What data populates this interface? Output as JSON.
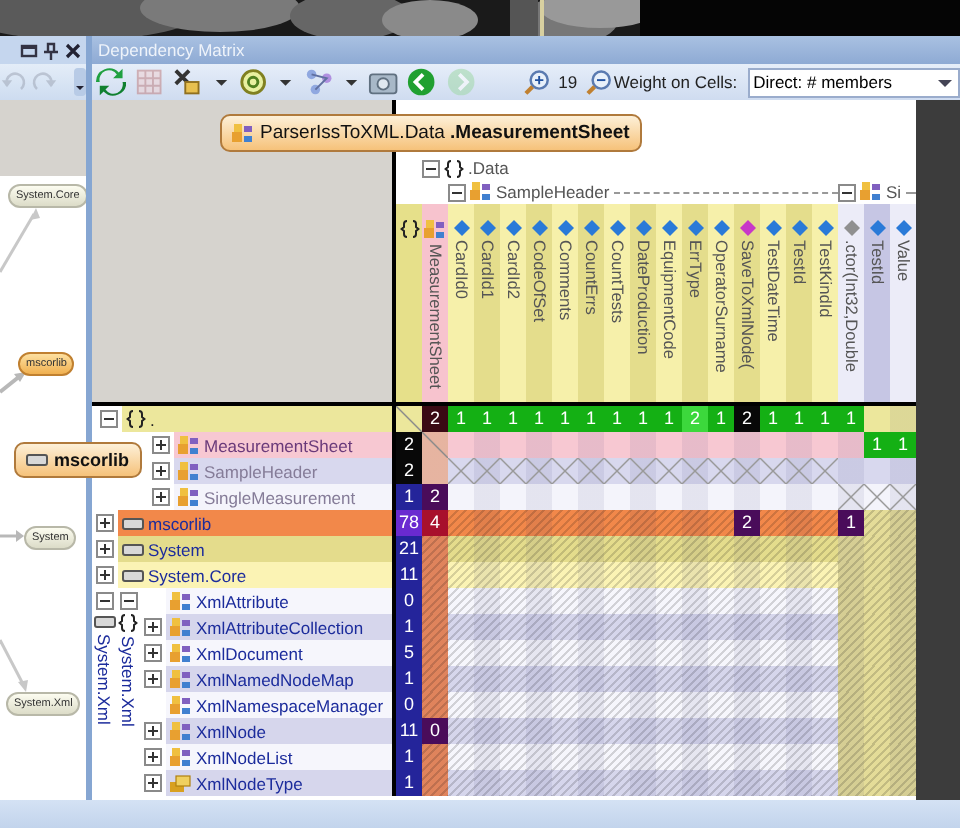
{
  "side_panel": {
    "buttons": [
      {
        "kind": "undo",
        "disabled": true
      },
      {
        "kind": "redo",
        "disabled": true
      }
    ],
    "graph_nodes": [
      {
        "label": "System.Core",
        "highlighted": false
      },
      {
        "label": "mscorlib",
        "highlighted": true
      },
      {
        "label": "System",
        "highlighted": false
      },
      {
        "label": "System.Xml",
        "highlighted": false
      }
    ]
  },
  "window": {
    "title": "Dependency Matrix"
  },
  "toolbar": {
    "buttons": [
      {
        "kind": "refresh",
        "disabled": false
      },
      {
        "kind": "grid",
        "disabled": true
      },
      {
        "kind": "tools",
        "disabled": false
      },
      {
        "kind": "caret",
        "disabled": false
      },
      {
        "kind": "ring",
        "disabled": false
      },
      {
        "kind": "caret",
        "disabled": false
      },
      {
        "kind": "graph",
        "disabled": false
      },
      {
        "kind": "caret",
        "disabled": false
      },
      {
        "kind": "camera",
        "disabled": false
      },
      {
        "kind": "back",
        "disabled": false
      },
      {
        "kind": "forward",
        "disabled": true
      }
    ],
    "zoom": "19",
    "weight_label": "Weight on Cells:",
    "weight_value": "Direct: # members"
  },
  "tooltips": [
    {
      "text": "ParserIssToXML.Data **.MeasurementSheet**",
      "kind": "class"
    },
    {
      "text": "mscorlib",
      "kind": "assembly"
    }
  ],
  "matrix": {
    "namespace": {
      "label": ".Data",
      "expanded": true
    },
    "columns": [
      {
        "kind": "namespace",
        "highlighted": false
      },
      {
        "label": "MeasurementSheet",
        "kind": "class",
        "highlighted": true
      }
    ],
    "groups": [
      {
        "label": "SampleHeader",
        "expanded": true,
        "columns": [
          {
            "label": "CardId0",
            "kind": "field",
            "highlighted": false
          },
          {
            "label": "CardId1",
            "kind": "field",
            "highlighted": false
          },
          {
            "label": "CardId2",
            "kind": "field",
            "highlighted": false
          },
          {
            "label": "CodeOfSet",
            "kind": "field",
            "highlighted": false
          },
          {
            "label": "Comments",
            "kind": "field",
            "highlighted": false
          },
          {
            "label": "CountErrs",
            "kind": "field",
            "highlighted": false
          },
          {
            "label": "CountTests",
            "kind": "field",
            "highlighted": false
          },
          {
            "label": "DateProduction",
            "kind": "field",
            "highlighted": false
          },
          {
            "label": "EquipmentCode",
            "kind": "field",
            "highlighted": false
          },
          {
            "label": "ErrType",
            "kind": "field",
            "highlighted": false
          },
          {
            "label": "OperatorSurname",
            "kind": "field",
            "highlighted": false
          },
          {
            "label": "SaveToXmlNode(",
            "kind": "method",
            "highlighted": false
          },
          {
            "label": "TestDateTime",
            "kind": "field",
            "highlighted": false
          },
          {
            "label": "TestId",
            "kind": "field",
            "highlighted": false
          },
          {
            "label": "TestKindId",
            "kind": "field",
            "highlighted": false
          }
        ]
      },
      {
        "label": "Si",
        "expanded": true,
        "columns": [
          {
            "label": ".ctor(Int32,Double",
            "kind": "ctor",
            "highlighted": false
          },
          {
            "label": "TestId",
            "kind": "field",
            "highlighted": false
          },
          {
            "label": "Value",
            "kind": "field",
            "highlighted": false
          }
        ]
      }
    ],
    "tree": [
      {
        "label": ".",
        "kind": "namespace",
        "expanded": true,
        "cells": [
          {
            "kind": "self"
          },
          {
            "value": "2",
            "kind": "dark"
          },
          {
            "value": "1",
            "kind": "uses"
          },
          {
            "value": "1",
            "kind": "uses"
          },
          {
            "value": "1",
            "kind": "uses"
          },
          {
            "value": "1",
            "kind": "uses"
          },
          {
            "value": "1",
            "kind": "uses"
          },
          {
            "value": "1",
            "kind": "uses"
          },
          {
            "value": "1",
            "kind": "uses"
          },
          {
            "value": "1",
            "kind": "uses"
          },
          {
            "value": "1",
            "kind": "uses"
          },
          {
            "value": "2",
            "kind": "uses-high"
          },
          {
            "value": "1",
            "kind": "uses"
          },
          {
            "value": "2",
            "kind": "cycle"
          },
          {
            "value": "1",
            "kind": "uses"
          },
          {
            "value": "1",
            "kind": "uses"
          },
          {
            "value": "1",
            "kind": "uses"
          },
          {
            "value": "1",
            "kind": "uses"
          }
        ],
        "children": [
          {
            "label": "MeasurementSheet",
            "kind": "class",
            "highlighted": true,
            "expanded": false,
            "cells": [
              {
                "value": "2",
                "kind": "cycle"
              },
              {
                "kind": "self"
              },
              null,
              null,
              null,
              null,
              null,
              null,
              null,
              null,
              null,
              null,
              null,
              null,
              null,
              null,
              null,
              null,
              {
                "value": "1",
                "kind": "uses"
              },
              {
                "value": "1",
                "kind": "uses"
              }
            ]
          },
          {
            "label": "SampleHeader",
            "kind": "class",
            "highlighted": false,
            "expanded": false,
            "cells": [
              {
                "value": "2",
                "kind": "cycle"
              },
              null,
              {
                "kind": "cross"
              },
              {
                "kind": "cross"
              },
              {
                "kind": "cross"
              },
              {
                "kind": "cross"
              },
              {
                "kind": "cross"
              },
              {
                "kind": "cross"
              },
              {
                "kind": "cross"
              },
              {
                "kind": "cross"
              },
              {
                "kind": "cross"
              },
              {
                "kind": "cross"
              },
              {
                "kind": "cross"
              },
              {
                "kind": "cross"
              },
              {
                "kind": "cross"
              },
              {
                "kind": "cross"
              },
              {
                "kind": "cross"
              }
            ]
          },
          {
            "label": "SingleMeasurement",
            "kind": "class",
            "highlighted": false,
            "expanded": false,
            "cells": [
              {
                "value": "1",
                "kind": "count"
              },
              {
                "value": "2",
                "kind": "used-by"
              },
              null,
              null,
              null,
              null,
              null,
              null,
              null,
              null,
              null,
              null,
              null,
              null,
              null,
              null,
              null,
              {
                "kind": "cross"
              },
              {
                "kind": "cross"
              },
              {
                "kind": "cross"
              }
            ]
          }
        ]
      },
      {
        "label": "mscorlib",
        "kind": "assembly",
        "highlighted": true,
        "expanded": false,
        "cells": [
          {
            "value": "78",
            "kind": "total"
          },
          {
            "value": "4",
            "kind": "hot"
          },
          null,
          null,
          null,
          null,
          null,
          null,
          null,
          null,
          null,
          null,
          null,
          {
            "value": "2",
            "kind": "used-by"
          },
          null,
          null,
          null,
          {
            "value": "1",
            "kind": "used-by"
          }
        ]
      },
      {
        "label": "System",
        "kind": "assembly",
        "highlighted": false,
        "expanded": false,
        "cells": [
          {
            "value": "21",
            "kind": "count"
          }
        ]
      },
      {
        "label": "System.Core",
        "kind": "assembly",
        "highlighted": false,
        "expanded": false,
        "cells": [
          {
            "value": "11",
            "kind": "count"
          }
        ]
      },
      {
        "label": "System.Xml",
        "kind": "assembly",
        "expanded": true,
        "children": [
          {
            "label": "System.Xml",
            "kind": "namespace",
            "expanded": true,
            "children": [
              {
                "label": "XmlAttribute",
                "kind": "class",
                "highlighted": false,
                "cells": [
                  {
                    "value": "0",
                    "kind": "count"
                  }
                ]
              },
              {
                "label": "XmlAttributeCollection",
                "kind": "class",
                "highlighted": false,
                "expanded": false,
                "cells": [
                  {
                    "value": "1",
                    "kind": "count"
                  }
                ]
              },
              {
                "label": "XmlDocument",
                "kind": "class",
                "highlighted": false,
                "expanded": false,
                "cells": [
                  {
                    "value": "5",
                    "kind": "count"
                  }
                ]
              },
              {
                "label": "XmlNamedNodeMap",
                "kind": "class",
                "highlighted": false,
                "expanded": false,
                "cells": [
                  {
                    "value": "1",
                    "kind": "count"
                  }
                ]
              },
              {
                "label": "XmlNamespaceManager",
                "kind": "class",
                "highlighted": false,
                "cells": [
                  {
                    "value": "0",
                    "kind": "count"
                  }
                ]
              },
              {
                "label": "XmlNode",
                "kind": "class",
                "highlighted": false,
                "expanded": false,
                "cells": [
                  {
                    "value": "11",
                    "kind": "count"
                  },
                  {
                    "value": "0",
                    "kind": "used-by"
                  }
                ]
              },
              {
                "label": "XmlNodeList",
                "kind": "class",
                "highlighted": false,
                "expanded": false,
                "cells": [
                  {
                    "value": "1",
                    "kind": "count"
                  }
                ]
              },
              {
                "label": "XmlNodeType",
                "kind": "enum",
                "highlighted": false,
                "expanded": false,
                "cells": [
                  {
                    "value": "1",
                    "kind": "count"
                  }
                ]
              }
            ]
          }
        ]
      }
    ]
  }
}
